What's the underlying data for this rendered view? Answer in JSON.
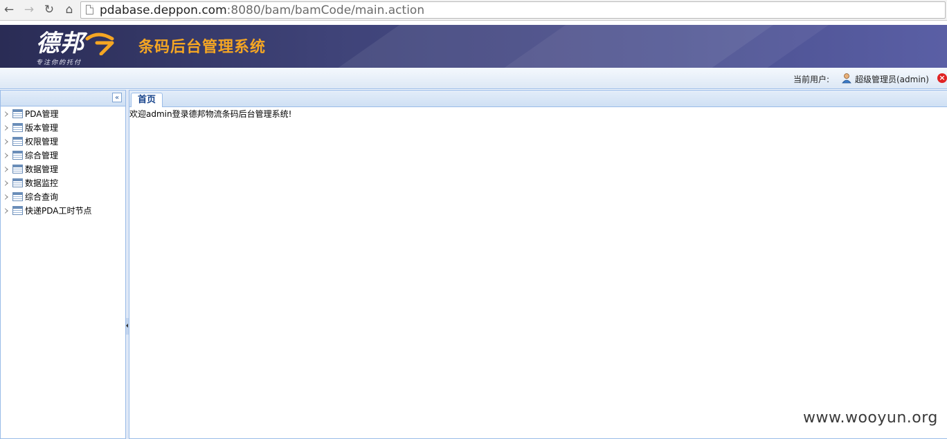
{
  "browser": {
    "url_host": "pdabase.deppon.com",
    "url_path": ":8080/bam/bamCode/main.action"
  },
  "header": {
    "logo_text": "德邦",
    "logo_slogan": "专注你的托付",
    "system_title": "条码后台管理系统",
    "colors": {
      "banner": "#3f4378",
      "title": "#f5a623"
    }
  },
  "user_bar": {
    "current_user_label": "当前用户:",
    "user_name": "超级管理员(admin)"
  },
  "sidebar": {
    "items": [
      {
        "label": "PDA管理"
      },
      {
        "label": "版本管理"
      },
      {
        "label": "权限管理"
      },
      {
        "label": "综合管理"
      },
      {
        "label": "数据管理"
      },
      {
        "label": "数据监控"
      },
      {
        "label": "综合查询"
      },
      {
        "label": "快递PDA工时节点"
      }
    ]
  },
  "tabs": [
    {
      "label": "首页"
    }
  ],
  "main": {
    "welcome_text": "欢迎admin登录德邦物流条码后台管理系统!"
  },
  "watermark": "www.wooyun.org"
}
